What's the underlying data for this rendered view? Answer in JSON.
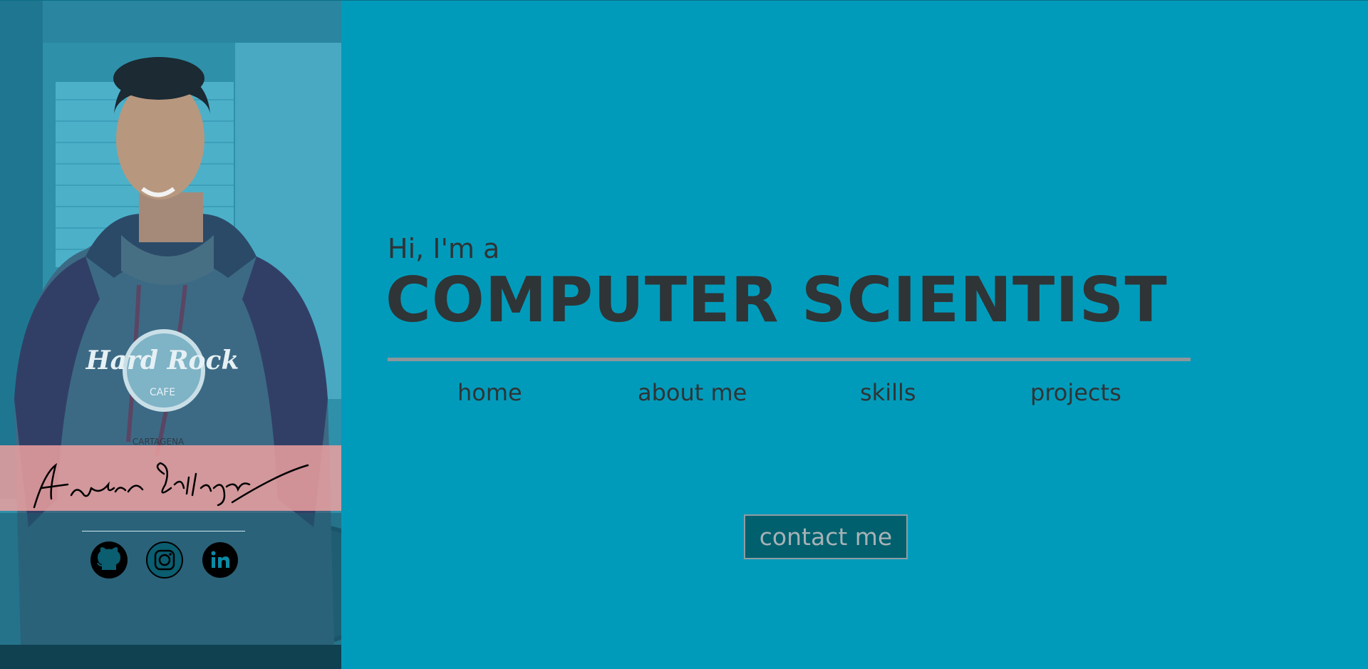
{
  "hero": {
    "greeting": "Hi, I'm a",
    "headline": "COMPUTER SCIENTIST"
  },
  "nav": {
    "home": "home",
    "about": "about me",
    "skills": "skills",
    "projects": "projects"
  },
  "contact": {
    "label": "contact me"
  },
  "sidebar": {
    "signature": "Andres Gallego",
    "shirt_logo_line1": "Hard Rock",
    "shirt_logo_line2": "CAFE",
    "shirt_text": "CARTAGENA",
    "social_icons": [
      "github-icon",
      "instagram-icon",
      "linkedin-icon"
    ]
  },
  "colors": {
    "background": "#009bbb",
    "text": "#2f3436",
    "rule": "#8e969a",
    "button_bg": "#00606e",
    "button_text": "#a6b2b6",
    "signature_band": "#eca0a0"
  }
}
